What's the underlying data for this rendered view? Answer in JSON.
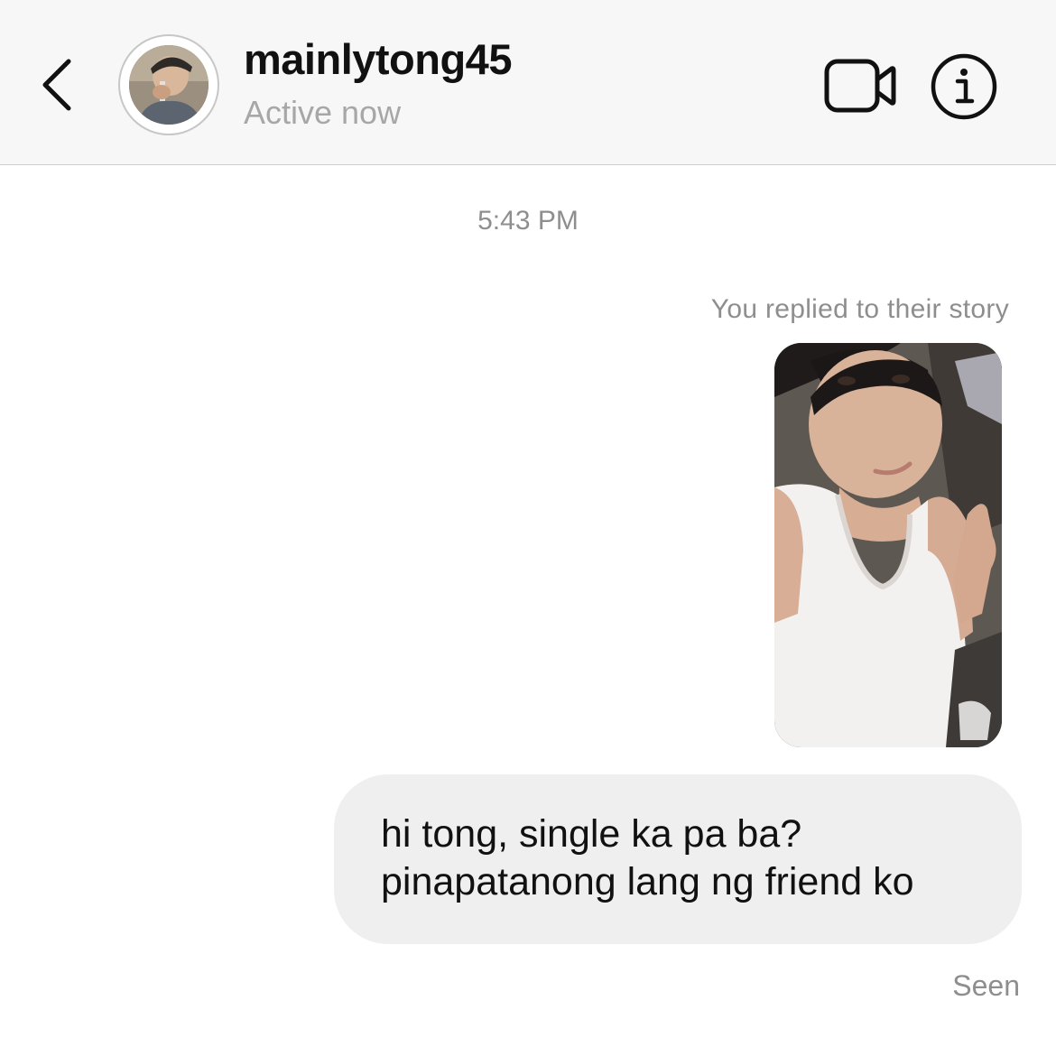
{
  "header": {
    "back_icon": "chevron-left-icon",
    "username": "mainlytong45",
    "status": "Active now",
    "video_icon": "video-camera-icon",
    "info_icon": "info-circle-icon"
  },
  "thread": {
    "timestamp": "5:43 PM",
    "reply_note": "You replied to their story",
    "message_lines": [
      "hi tong, single ka pa ba?",
      "pinapatanong lang ng friend ko"
    ],
    "seen_label": "Seen"
  },
  "colors": {
    "header_bg": "#f7f7f7",
    "bubble_bg": "#efefef",
    "muted_text": "#8e8e8e",
    "status_text": "#a7a7a7"
  }
}
